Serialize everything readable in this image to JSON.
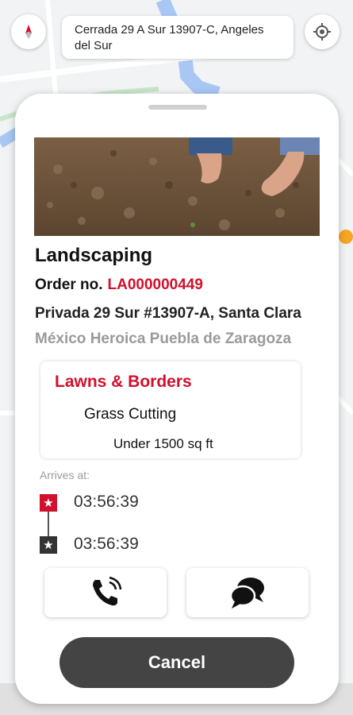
{
  "map": {
    "address": "Cerrada 29 A Sur 13907-C, Angeles del Sur"
  },
  "service": {
    "title": "Landscaping",
    "order_label": "Order no.",
    "order_number": "LA000000449",
    "address_line1": "Privada 29 Sur #13907-A, Santa Clara",
    "address_line2": "México Heroica Puebla de Zaragoza",
    "category": "Lawns & Borders",
    "name": "Grass Cutting",
    "size": "Under 1500 sq ft"
  },
  "arrival": {
    "label": "Arrives at:",
    "time_start": "03:56:39",
    "time_end": "03:56:39"
  },
  "actions": {
    "call_icon": "phone-icon",
    "chat_icon": "chat-icon",
    "cancel_label": "Cancel"
  },
  "colors": {
    "accent": "#d0102c",
    "dark": "#444444"
  }
}
